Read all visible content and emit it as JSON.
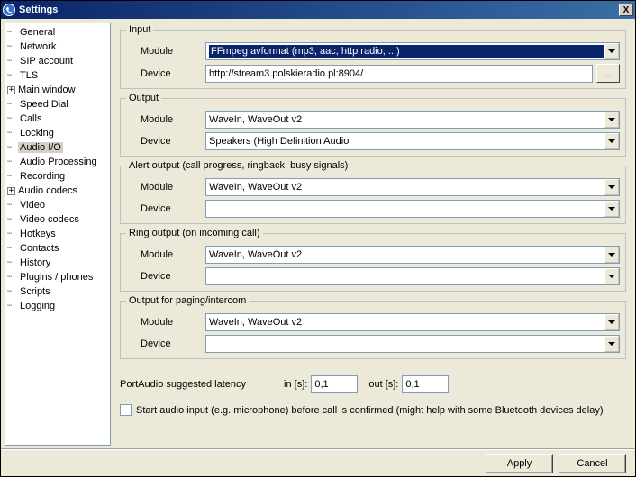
{
  "window": {
    "title": "Settings",
    "close_x": "X"
  },
  "tree": [
    {
      "label": "General",
      "expander": null
    },
    {
      "label": "Network",
      "expander": null
    },
    {
      "label": "SIP account",
      "expander": null
    },
    {
      "label": "TLS",
      "expander": null
    },
    {
      "label": "Main window",
      "expander": "+"
    },
    {
      "label": "Speed Dial",
      "expander": null
    },
    {
      "label": "Calls",
      "expander": null
    },
    {
      "label": "Locking",
      "expander": null
    },
    {
      "label": "Audio I/O",
      "expander": null,
      "selected": true
    },
    {
      "label": "Audio Processing",
      "expander": null
    },
    {
      "label": "Recording",
      "expander": null
    },
    {
      "label": "Audio codecs",
      "expander": "+"
    },
    {
      "label": "Video",
      "expander": null
    },
    {
      "label": "Video codecs",
      "expander": null
    },
    {
      "label": "Hotkeys",
      "expander": null
    },
    {
      "label": "Contacts",
      "expander": null
    },
    {
      "label": "History",
      "expander": null
    },
    {
      "label": "Plugins / phones",
      "expander": null
    },
    {
      "label": "Scripts",
      "expander": null
    },
    {
      "label": "Logging",
      "expander": null
    }
  ],
  "labels": {
    "module": "Module",
    "device": "Device",
    "browse": "..."
  },
  "input": {
    "legend": "Input",
    "module": "FFmpeg avformat (mp3, aac, http radio, ...)",
    "device": "http://stream3.polskieradio.pl:8904/"
  },
  "output": {
    "legend": "Output",
    "module": "WaveIn, WaveOut v2",
    "device": "Speakers (High Definition Audio"
  },
  "alert": {
    "legend": "Alert output (call progress, ringback, busy signals)",
    "module": "WaveIn, WaveOut v2",
    "device": ""
  },
  "ring": {
    "legend": "Ring output (on incoming call)",
    "module": "WaveIn, WaveOut v2",
    "device": ""
  },
  "paging": {
    "legend": "Output for paging/intercom",
    "module": "WaveIn, WaveOut v2",
    "device": ""
  },
  "latency": {
    "label": "PortAudio suggested latency",
    "in_label": "in [s]:",
    "in_value": "0,1",
    "out_label": "out [s]:",
    "out_value": "0,1"
  },
  "check_start_audio": "Start audio input (e.g. microphone) before call is confirmed (might help with some Bluetooth devices delay)",
  "buttons": {
    "apply": "Apply",
    "cancel": "Cancel"
  }
}
